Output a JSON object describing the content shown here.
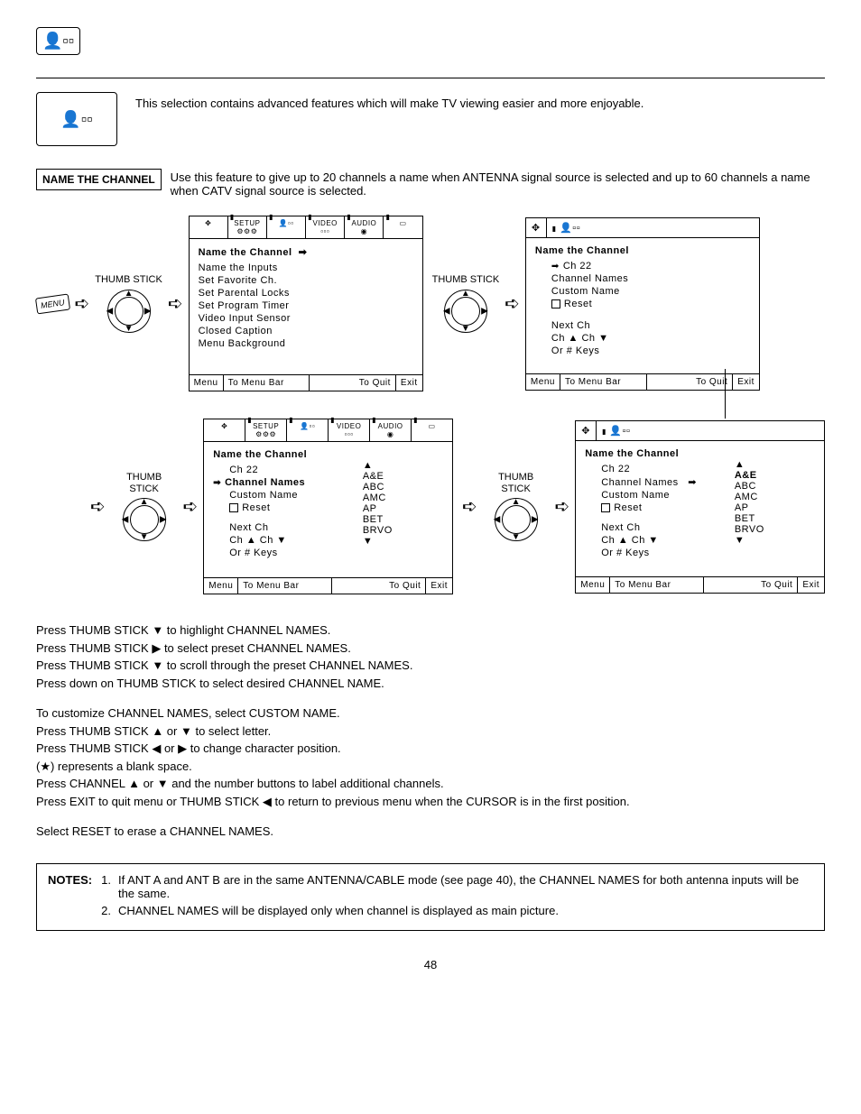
{
  "intro_text": "This selection contains advanced features which will make TV viewing easier and more enjoyable.",
  "feature": {
    "label": "NAME THE CHANNEL",
    "desc": "Use this feature to give up to 20 channels a name when ANTENNA signal source is selected and up to 60 channels a name when CATV signal source is selected."
  },
  "thumb_label": "THUMB STICK",
  "menu_key": "MENU",
  "tabs": {
    "setup": "SETUP",
    "video": "VIDEO",
    "audio": "AUDIO"
  },
  "screen1": {
    "title": "Name the Channel",
    "items": [
      "Name the Inputs",
      "Set Favorite Ch.",
      "Set Parental Locks",
      "Set Program Timer",
      "Video Input Sensor",
      "Closed Caption",
      "Menu Background"
    ]
  },
  "screen2": {
    "title": "Name the Channel",
    "ch": "Ch 22",
    "items": [
      "Channel Names",
      "Custom Name"
    ],
    "reset": "Reset",
    "next": "Next Ch",
    "chkeys": "Ch ▲ Ch ▼",
    "or": "Or # Keys"
  },
  "screen3": {
    "title": "Name the Channel",
    "ch": "Ch 22",
    "sel_item": "Channel Names",
    "custom": "Custom Name",
    "reset": "Reset",
    "next": "Next Ch",
    "chkeys": "Ch ▲ Ch ▼",
    "or": "Or # Keys",
    "names": [
      "A&E",
      "ABC",
      "AMC",
      "AP",
      "BET",
      "BRVO"
    ]
  },
  "screen4": {
    "title": "Name the Channel",
    "ch": "Ch 22",
    "items": [
      "Channel Names",
      "Custom Name"
    ],
    "reset": "Reset",
    "next": "Next Ch",
    "chkeys": "Ch ▲ Ch ▼",
    "or": "Or # Keys",
    "sel_name": "A&E",
    "names": [
      "ABC",
      "AMC",
      "AP",
      "BET",
      "BRVO"
    ]
  },
  "footer": {
    "menu": "Menu",
    "tomenu": "To Menu Bar",
    "toquit": "To Quit",
    "exit": "Exit"
  },
  "instructions": {
    "b1": [
      "Press THUMB STICK ▼ to highlight CHANNEL NAMES.",
      "Press THUMB STICK ▶ to select preset CHANNEL NAMES.",
      "Press THUMB STICK ▼ to scroll through the preset CHANNEL NAMES.",
      "Press down on THUMB STICK to select desired CHANNEL NAME."
    ],
    "b2": [
      "To customize CHANNEL NAMES, select CUSTOM NAME.",
      "Press THUMB STICK ▲ or ▼ to select letter.",
      "Press THUMB STICK ◀ or ▶ to change character position.",
      "(★) represents a blank space.",
      "Press CHANNEL ▲ or ▼ and the number buttons to label additional channels.",
      "Press EXIT to quit menu or THUMB STICK ◀ to return to previous menu when the CURSOR is in the first position."
    ],
    "b3": [
      "Select RESET to erase a CHANNEL NAMES."
    ]
  },
  "notes": {
    "label": "NOTES:",
    "items": [
      {
        "n": "1.",
        "t": "If ANT A and ANT B are in the same ANTENNA/CABLE mode (see page 40), the CHANNEL NAMES for both antenna inputs will be the same."
      },
      {
        "n": "2.",
        "t": "CHANNEL NAMES will be displayed only when channel is displayed as main picture."
      }
    ]
  },
  "page": "48"
}
